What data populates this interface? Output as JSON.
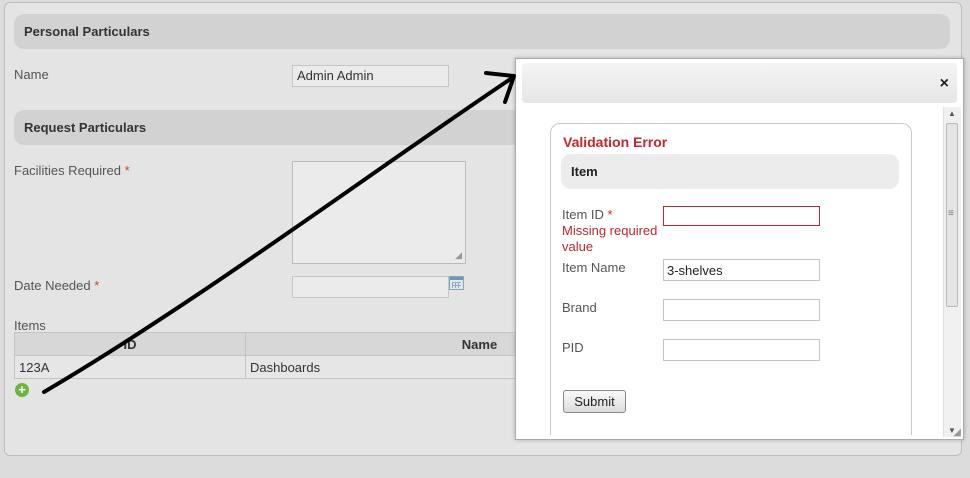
{
  "form": {
    "personal_header": "Personal Particulars",
    "name_label": "Name",
    "name_value": "Admin Admin",
    "request_header": "Request Particulars",
    "facilities_label": "Facilities Required",
    "date_label": "Date Needed",
    "required_marker": "*",
    "items_label": "Items",
    "table": {
      "columns": [
        "ID",
        "Name"
      ],
      "rows": [
        {
          "id": "123A",
          "name": "Dashboards"
        }
      ]
    }
  },
  "modal": {
    "close_symbol": "×",
    "validation_title": "Validation Error",
    "section_header": "Item",
    "item_id_label": "Item ID",
    "item_id_value": "",
    "error_message": "Missing required value",
    "item_name_label": "Item Name",
    "item_name_value": "3-shelves",
    "brand_label": "Brand",
    "brand_value": "",
    "pid_label": "PID",
    "pid_value": "",
    "submit_label": "Submit"
  },
  "colors": {
    "error_red": "#c0272d",
    "required_red": "#cc4433",
    "add_green": "#6cb33f"
  },
  "icons": [
    "calendar-icon",
    "add-circle-icon",
    "close-icon",
    "resize-grip-icon"
  ]
}
